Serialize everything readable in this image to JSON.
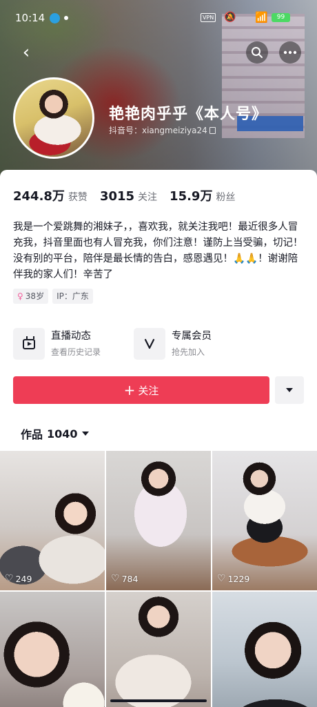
{
  "status_bar": {
    "time": "10:14",
    "vpn": "VPN",
    "battery": "99"
  },
  "header": {
    "back_icon": "chevron-left-icon",
    "search_icon": "search-icon",
    "more_icon": "more-dots-icon"
  },
  "profile": {
    "name": "艳艳肉乎乎《本人号》",
    "douyin_id": "抖音号：xiangmeiziya24"
  },
  "stats": [
    {
      "value": "244.8万",
      "label": "获赞"
    },
    {
      "value": "3015",
      "label": "关注"
    },
    {
      "value": "15.9万",
      "label": "粉丝"
    }
  ],
  "bio": "我是一个爱跳舞的湘妹子，，喜欢我，就关注我吧！最近很多人冒充我，抖音里面也有人冒充我，你们注意！谨防上当受骗，切记！没有别的平台，陪伴是最长情的告白，感恩遇见！🙏🙏！谢谢陪伴我的家人们！辛苦了",
  "tags": {
    "gender_symbol": "♀",
    "age": "38岁",
    "ip": "IP：广东"
  },
  "features": [
    {
      "title": "直播动态",
      "subtitle": "查看历史记录",
      "icon": "tv-icon"
    },
    {
      "title": "专属会员",
      "subtitle": "抢先加入",
      "icon": "v-icon"
    }
  ],
  "actions": {
    "follow_plus": "+",
    "follow_label": "关注"
  },
  "works_tab": {
    "label": "作品",
    "count": "1040"
  },
  "videos": [
    {
      "likes": "249"
    },
    {
      "likes": "784"
    },
    {
      "likes": "1229"
    },
    {
      "likes": ""
    },
    {
      "likes": ""
    },
    {
      "likes": ""
    }
  ],
  "colors": {
    "accent": "#ee3d55",
    "text_primary": "#161823",
    "text_secondary": "#6b6d75",
    "tag_bg": "#f2f2f4"
  }
}
